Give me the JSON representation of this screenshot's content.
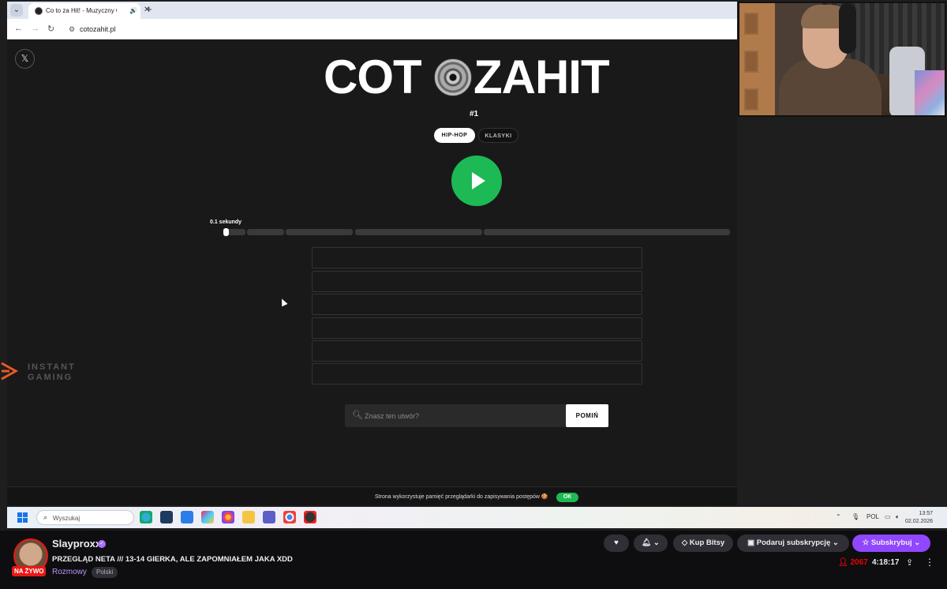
{
  "browser": {
    "tab_title": "Co to za Hit! - Muzyczny Q...",
    "new_tab": "+",
    "url": "cotozahit.pl"
  },
  "site": {
    "logo_left": "COT",
    "logo_right": "ZAHIT",
    "puzzle_number": "#1",
    "genres": [
      "HIP-HOP",
      "KLASYKI"
    ],
    "active_genre": "HIP-HOP",
    "time_label": "0.1 sekundy",
    "guess_rows": 6,
    "search_placeholder": "Znasz ten utwór?",
    "skip_label": "POMIŃ",
    "sponsor_line1": "INSTANT",
    "sponsor_line2": "GAMING",
    "cookie_text": "Strona wykorzystuje pamięć przeglądarki do zapisywania postępów 🍪",
    "cookie_ok": "OK"
  },
  "taskbar": {
    "search_placeholder": "Wyszukaj",
    "language": "POL",
    "time": "13:57",
    "date": "02.02.2026"
  },
  "twitch": {
    "live_badge": "NA ŻYWO",
    "channel": "Slayproxx",
    "title": "PRZEGLĄD NETA /// 13-14 GIERKA, ALE ZAPOMNIAŁEM JAKA XDD",
    "category": "Rozmowy",
    "tag": "Polski",
    "buy_bits": "Kup Bitsy",
    "gift_sub": "Podaruj subskrypcję",
    "subscribe": "Subskrybuj",
    "viewers": "2067",
    "uptime": "4:18:17"
  },
  "colors": {
    "accent_green": "#1db954",
    "twitch_purple": "#9147ff",
    "live_red": "#e91916"
  }
}
